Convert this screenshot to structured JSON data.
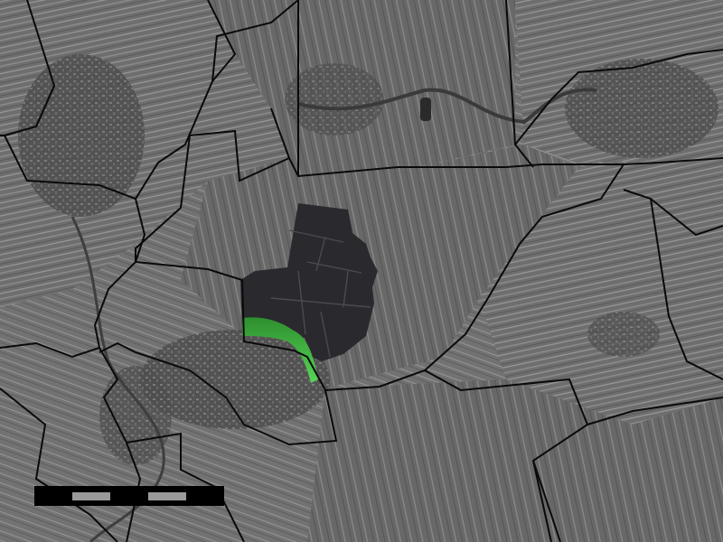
{
  "map": {
    "style": "grayscale aerial imagery with municipal boundaries",
    "colors": {
      "background": "#6b6b6b",
      "field_light": "#8a8a8a",
      "field_dark": "#4a4a4a",
      "built_up": "#555555",
      "border": "#0a0a0a",
      "highlight_region": "#2a2a2e",
      "highlight_edge": "#3fbf3f"
    }
  },
  "scale_bar": {
    "segments": 5,
    "pattern": [
      "dark",
      "light",
      "dark",
      "light",
      "dark"
    ]
  }
}
